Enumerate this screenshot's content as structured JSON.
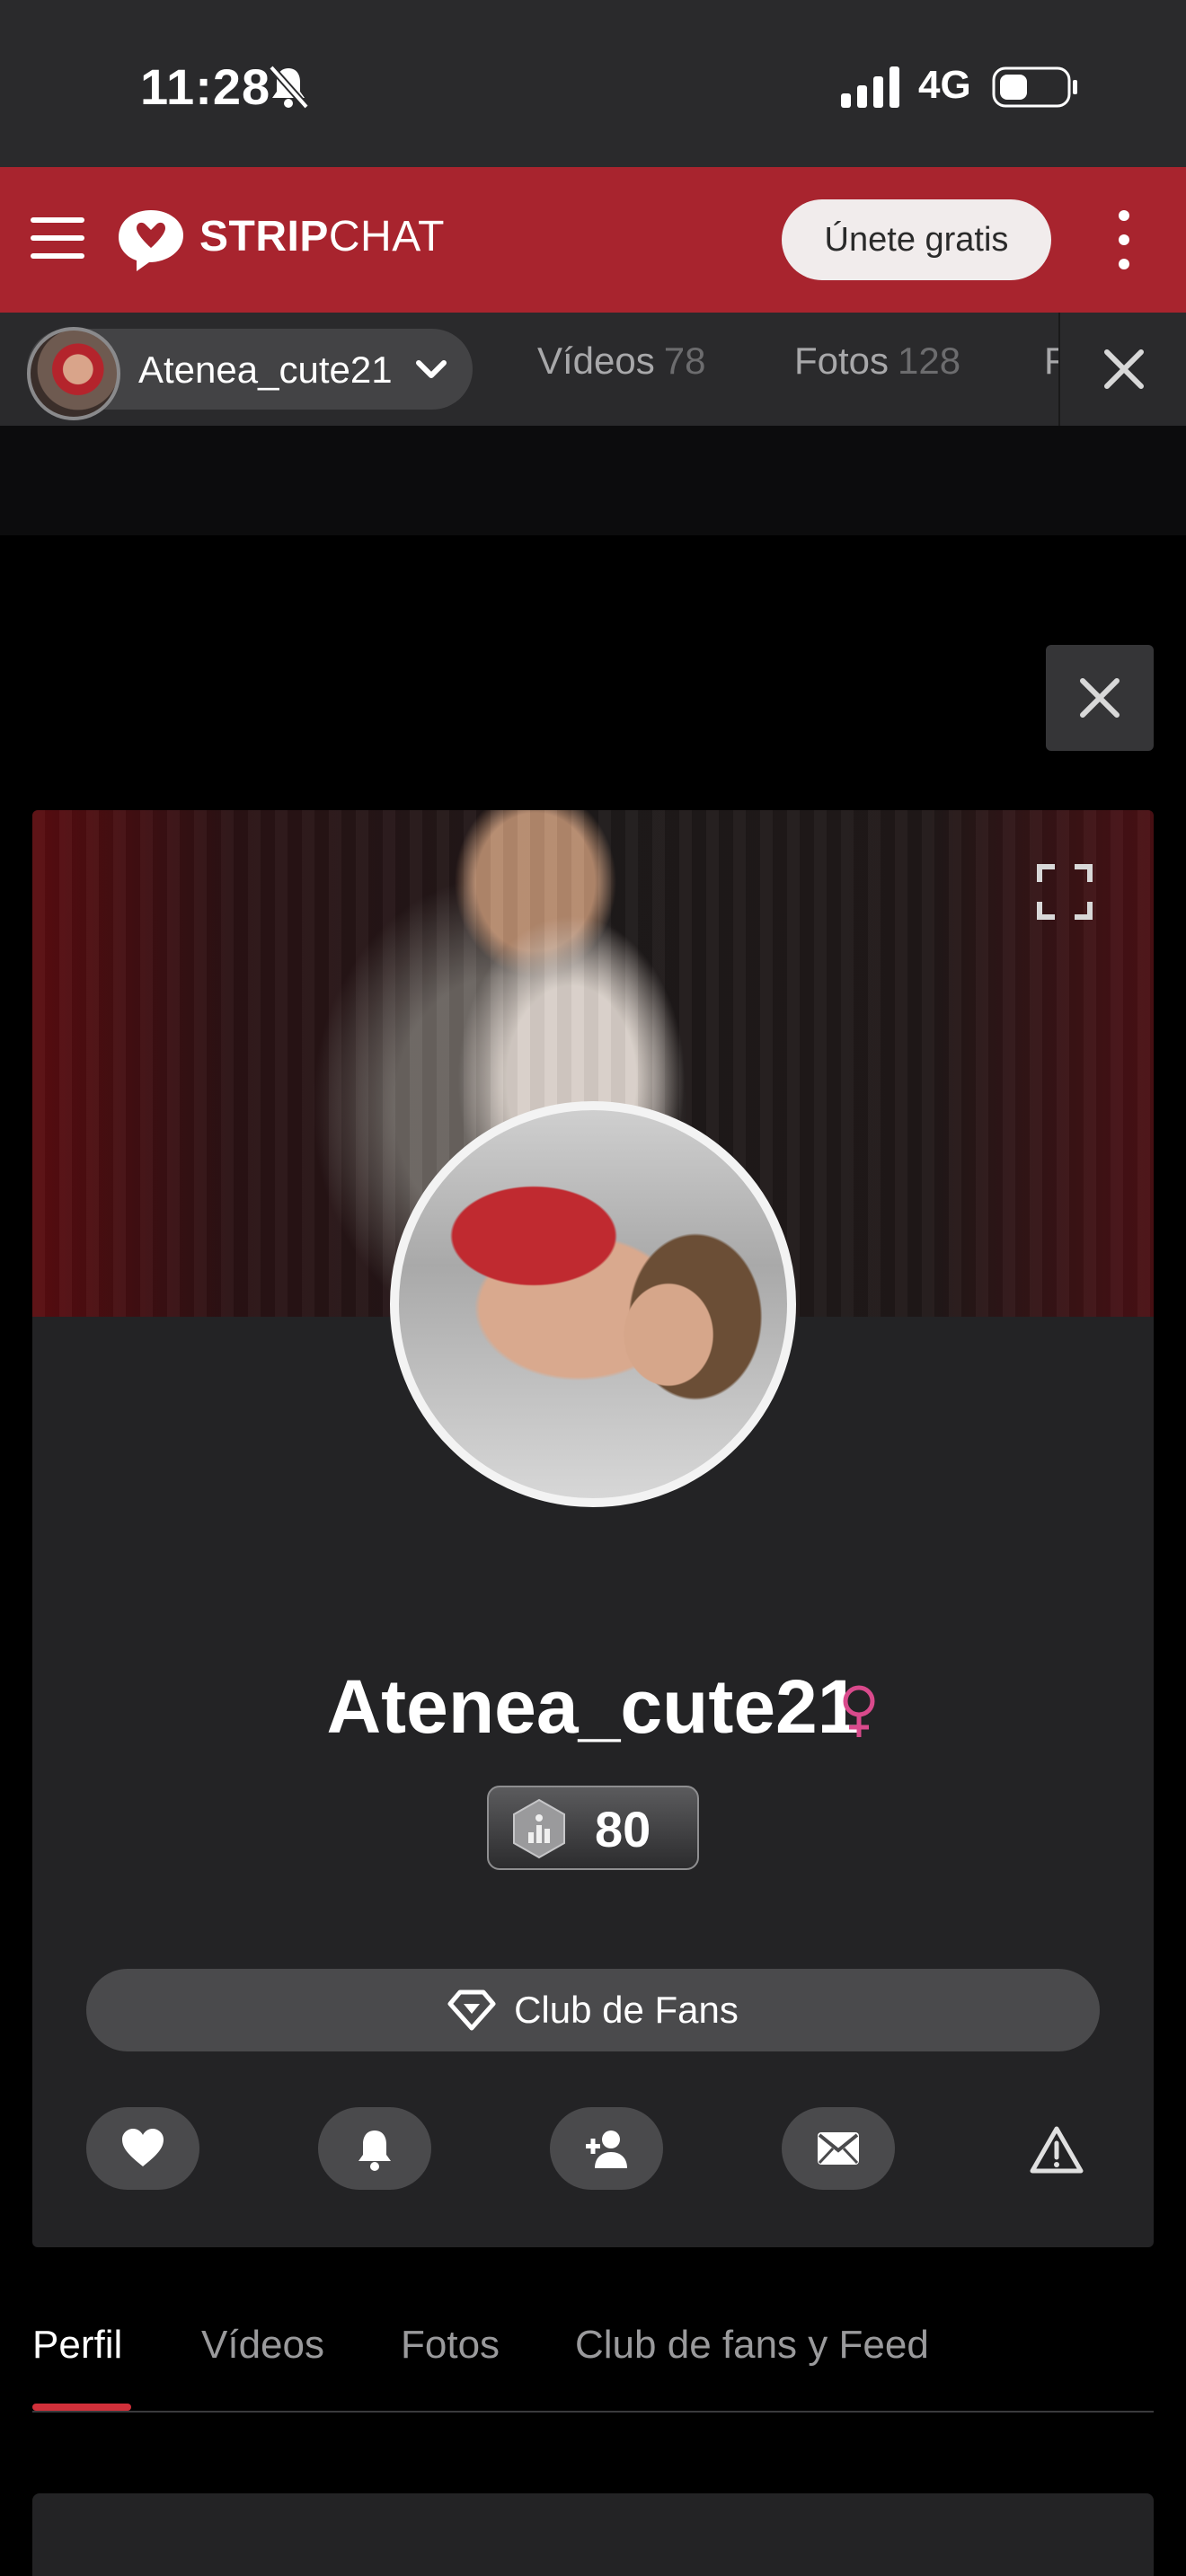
{
  "status_bar": {
    "time": "11:28",
    "network": "4G"
  },
  "header": {
    "logo_bold": "STRIP",
    "logo_light": "CHAT",
    "join_label": "Únete gratis",
    "brand_color": "#a8242e"
  },
  "subbar": {
    "model_name": "Atenea_cute21",
    "tabs": [
      {
        "label": "Vídeos",
        "count": "78"
      },
      {
        "label": "Fotos",
        "count": "128"
      },
      {
        "label": "F",
        "count": ""
      }
    ]
  },
  "profile": {
    "name": "Atenea_cute21",
    "gender_symbol": "♀",
    "level": "80",
    "fan_club_label": "Club de Fans",
    "actions": [
      "heart-icon",
      "bell-icon",
      "add-user-icon",
      "mail-icon",
      "warning-icon"
    ]
  },
  "tabs": [
    {
      "label": "Perfil",
      "active": true
    },
    {
      "label": "Vídeos",
      "active": false
    },
    {
      "label": "Fotos",
      "active": false
    },
    {
      "label": "Club de fans y Feed",
      "active": false
    }
  ]
}
